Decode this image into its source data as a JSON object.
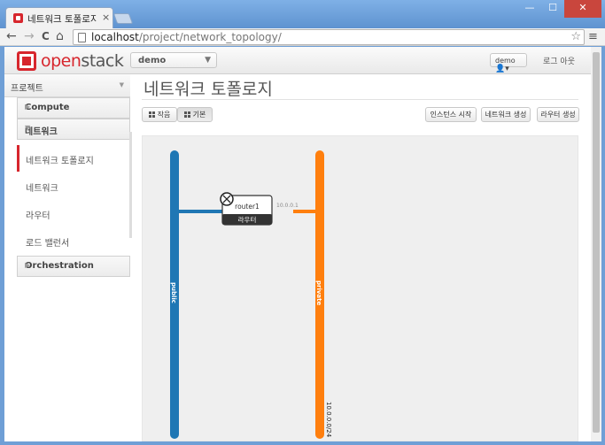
{
  "browser": {
    "tab_title": "네트워크 토폴로지 - Ope",
    "tab_close": "×",
    "url_host": "localhost",
    "url_path": "/project/network_topology/",
    "win_min": "—",
    "win_max": "☐",
    "win_close": "✕",
    "back": "←",
    "forward": "→",
    "reload": "C",
    "home": "⌂",
    "star": "☆",
    "menu": "≡"
  },
  "header": {
    "logo_a": "open",
    "logo_b": "stack",
    "project": "demo",
    "user": "demo",
    "signout": "로그 아웃"
  },
  "sidebar": {
    "section": "프로젝트",
    "compute": "Compute",
    "network": "네트워크",
    "items": [
      {
        "label": "네트워크 토폴로지"
      },
      {
        "label": "네트워크"
      },
      {
        "label": "라우터"
      },
      {
        "label": "로드 밸런서"
      }
    ],
    "orchestration": "Orchestration"
  },
  "main": {
    "title": "네트워크 토폴로지",
    "view_small": "작음",
    "view_normal": "기본",
    "launch_instance": "인스턴스 시작",
    "create_network": "네트워크 생성",
    "create_router": "라우터 생성"
  },
  "topology": {
    "networks": [
      {
        "name": "public",
        "color": "#1f77b4"
      },
      {
        "name": "private",
        "color": "#ff7f0e",
        "cidr": "10.0.0.0/24"
      }
    ],
    "router": {
      "name": "router1",
      "type_label": "라우터",
      "port_ip": "10.0.0.1"
    }
  }
}
